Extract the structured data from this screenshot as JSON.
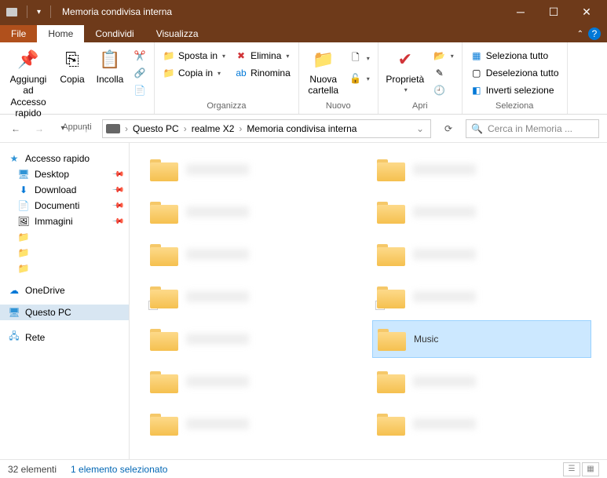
{
  "window": {
    "title": "Memoria condivisa interna"
  },
  "tabs": {
    "file": "File",
    "home": "Home",
    "share": "Condividi",
    "view": "Visualizza"
  },
  "ribbon": {
    "clipboard": {
      "pin": "Aggiungi ad\nAccesso rapido",
      "copy": "Copia",
      "paste": "Incolla",
      "label": "Appunti"
    },
    "organize": {
      "move": "Sposta in",
      "copy_to": "Copia in",
      "delete": "Elimina",
      "rename": "Rinomina",
      "label": "Organizza"
    },
    "new": {
      "folder": "Nuova\ncartella",
      "label": "Nuovo"
    },
    "open": {
      "properties": "Proprietà",
      "label": "Apri"
    },
    "select": {
      "all": "Seleziona tutto",
      "none": "Deseleziona tutto",
      "invert": "Inverti selezione",
      "label": "Seleziona"
    }
  },
  "breadcrumbs": [
    "Questo PC",
    "realme X2",
    "Memoria condivisa interna"
  ],
  "search": {
    "placeholder": "Cerca in Memoria ..."
  },
  "sidebar": {
    "quick": "Accesso rapido",
    "desktop": "Desktop",
    "download": "Download",
    "documents": "Documenti",
    "pictures": "Immagini",
    "onedrive": "OneDrive",
    "thispc": "Questo PC",
    "network": "Rete"
  },
  "selected_folder": "Music",
  "status": {
    "count": "32 elementi",
    "selected": "1 elemento selezionato"
  }
}
